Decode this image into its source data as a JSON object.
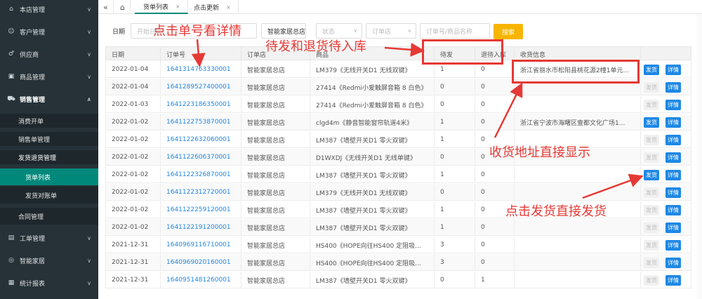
{
  "sidebar": {
    "items": [
      {
        "label": "本店管理",
        "icon": "home-icon"
      },
      {
        "label": "客户管理",
        "icon": "user-icon"
      },
      {
        "label": "供应商",
        "icon": "gender-icon"
      },
      {
        "label": "商品管理",
        "icon": "box-icon"
      },
      {
        "label": "销售管理",
        "icon": "cart-icon"
      },
      {
        "label": "消费开单"
      },
      {
        "label": "销售单管理"
      },
      {
        "label": "发货退货管理"
      },
      {
        "label": "货单列表"
      },
      {
        "label": "发货对账单"
      },
      {
        "label": "合同管理"
      },
      {
        "label": "工单管理",
        "icon": "document-icon"
      },
      {
        "label": "智能家居",
        "icon": "smart-home-icon"
      },
      {
        "label": "统计报表",
        "icon": "report-icon"
      }
    ]
  },
  "tabs": {
    "active": "货单列表",
    "other": "点击更新",
    "close_glyph": "×"
  },
  "filter": {
    "date_label": "日期",
    "date_placeholder": "开始日期",
    "store_value": "智能家居总店",
    "status_placeholder": "状态",
    "order_store_placeholder": "订单店",
    "keyword_placeholder": "订单号/商品名称",
    "search_label": "搜索"
  },
  "table": {
    "columns": [
      "日期",
      "订单号",
      "订单店",
      "商品",
      "待发",
      "退待入库",
      "收货信息"
    ],
    "ship_label": "发货",
    "detail_label": "详情",
    "rows": [
      {
        "date": "2022-01-04",
        "order": "1641314763330001",
        "store": "智能家居总店",
        "product": "LM379《无线开关D1 无线双键》",
        "pending": "1",
        "return": "0",
        "address": "浙江省丽水市松阳县桃花源2幢1单元...",
        "ship_enabled": true
      },
      {
        "date": "2022-01-04",
        "order": "1641289527400001",
        "store": "智能家居总店",
        "product": "27414《Redmi小爱触屏音箱 8 白色》",
        "pending": "0",
        "return": "0",
        "address": "",
        "ship_enabled": false
      },
      {
        "date": "2022-01-03",
        "order": "1641223186350001",
        "store": "智能家居总店",
        "product": "27414《Redmi小爱触屏音箱 8 白色》",
        "pending": "0",
        "return": "0",
        "address": "",
        "ship_enabled": false
      },
      {
        "date": "2022-01-02",
        "order": "1641122753870001",
        "store": "智能家居总店",
        "product": "clgd4m《静音智能窗帘轨道4米》",
        "pending": "1",
        "return": "0",
        "address": "浙江省宁波市海曙区壹都文化广场1...",
        "ship_enabled": true
      },
      {
        "date": "2022-01-02",
        "order": "1641122632060001",
        "store": "智能家居总店",
        "product": "LM387《墙壁开关D1 零火双键》",
        "pending": "1",
        "return": "0",
        "address": "",
        "ship_enabled": false
      },
      {
        "date": "2022-01-02",
        "order": "1641122606370001",
        "store": "智能家居总店",
        "product": "D1WXDJ《无线开关D1 无线单键》",
        "pending": "0",
        "return": "0",
        "address": "",
        "ship_enabled": false
      },
      {
        "date": "2022-01-02",
        "order": "1641122326870001",
        "store": "智能家居总店",
        "product": "LM387《墙壁开关D1 零火双键》",
        "pending": "1",
        "return": "0",
        "address": "",
        "ship_enabled": true
      },
      {
        "date": "2022-01-02",
        "order": "1641122312720001",
        "store": "智能家居总店",
        "product": "LM379《无线开关D1 无线双键》",
        "pending": "0",
        "return": "0",
        "address": "",
        "ship_enabled": false
      },
      {
        "date": "2022-01-02",
        "order": "1641122259120001",
        "store": "智能家居总店",
        "product": "LM387《墙壁开关D1 零火双键》",
        "pending": "1",
        "return": "0",
        "address": "",
        "ship_enabled": false
      },
      {
        "date": "2022-01-02",
        "order": "1641122191200001",
        "store": "智能家居总店",
        "product": "LM387《墙壁开关D1 零火双键》",
        "pending": "1",
        "return": "0",
        "address": "",
        "ship_enabled": false
      },
      {
        "date": "2021-12-31",
        "order": "1640969116710001",
        "store": "智能家居总店",
        "product": "HS400《HOPE向往HS400 定阻吸...",
        "pending": "3",
        "return": "0",
        "address": "",
        "ship_enabled": false
      },
      {
        "date": "2021-12-31",
        "order": "1640969020160001",
        "store": "智能家居总店",
        "product": "HS400《HOPE向往HS400 定阻吸...",
        "pending": "3",
        "return": "0",
        "address": "",
        "ship_enabled": false
      },
      {
        "date": "2021-12-31",
        "order": "1640951481260001",
        "store": "智能家居总店",
        "product": "LM387《墙壁开关D1 零火双键》",
        "pending": "0",
        "return": "1",
        "address": "",
        "ship_enabled": false
      }
    ]
  },
  "annotations": {
    "click_order": "点击单号看详情",
    "pending_return": "待发和退货待入库",
    "address_direct": "收货地址直接显示",
    "ship_direct": "点击发货直接发货"
  },
  "colors": {
    "sidebar_bg": "#263238",
    "selected_menu": "#00897b",
    "link": "#1e88e5",
    "search_button": "#f7b500",
    "annotation_red": "#e53935"
  }
}
